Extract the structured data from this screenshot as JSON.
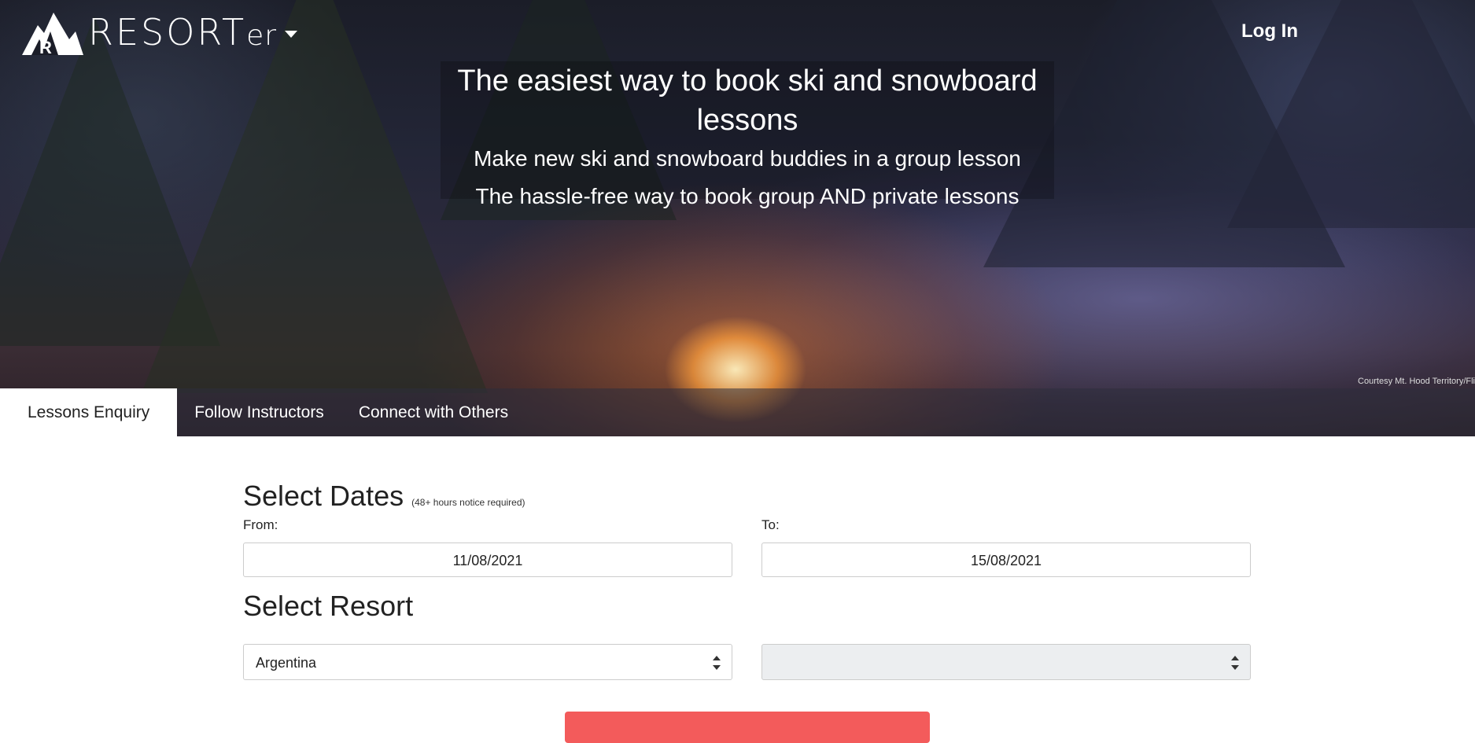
{
  "brand": {
    "name": "RESORT",
    "suffix": "er"
  },
  "header": {
    "login_label": "Log In"
  },
  "hero": {
    "headline": "The easiest way to book ski and snowboard lessons",
    "subline1": "Make new ski and snowboard buddies in a group lesson",
    "subline2": "The hassle-free way to book group AND private lessons",
    "credit": "Courtesy Mt. Hood Territory/Fli"
  },
  "tabs": [
    {
      "label": "Lessons Enquiry",
      "active": true
    },
    {
      "label": "Follow Instructors",
      "active": false
    },
    {
      "label": "Connect with Others",
      "active": false
    }
  ],
  "form": {
    "dates_title": "Select Dates",
    "dates_note": "(48+ hours notice required)",
    "from_label": "From:",
    "from_value": "11/08/2021",
    "to_label": "To:",
    "to_value": "15/08/2021",
    "resort_title": "Select Resort",
    "country_value": "Argentina",
    "resort_value": ""
  },
  "colors": {
    "accent": "#f35b5b",
    "tabbar": "#2d2d3c"
  },
  "icons": {
    "logo": "resorter-mountain-logo",
    "caret": "caret-down-icon",
    "select": "select-arrows-icon"
  }
}
